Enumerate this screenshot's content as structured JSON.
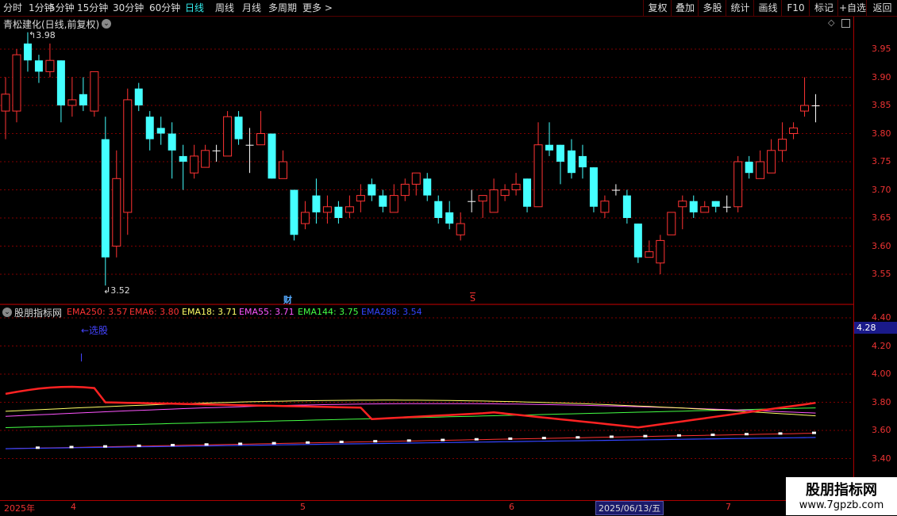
{
  "toolbar": {
    "tabs": [
      "分时",
      "1分钟",
      "5分钟",
      "15分钟",
      "30分钟",
      "60分钟",
      "日线",
      "周线",
      "月线",
      "多周期",
      "更多 >"
    ],
    "active_tab": "日线",
    "right_buttons": [
      "复权",
      "叠加",
      "多股",
      "统计",
      "画线",
      "F10",
      "标记",
      "+自选",
      "返回"
    ]
  },
  "main_panel": {
    "title": "青松建化(日线,前复权)",
    "high_marker": "3.98",
    "low_marker": "3.52",
    "event_markers": [
      "财",
      "S"
    ],
    "y_ticks": [
      "3.95",
      "3.90",
      "3.85",
      "3.80",
      "3.75",
      "3.70",
      "3.65",
      "3.60",
      "3.55"
    ]
  },
  "indicator_panel": {
    "title": "股朋指标网",
    "ema": [
      {
        "label": "EMA250: 3.57",
        "color": "#ff3333"
      },
      {
        "label": "EMA6: 3.80",
        "color": "#ff3333"
      },
      {
        "label": "EMA18: 3.71",
        "color": "#ffff66"
      },
      {
        "label": "EMA55: 3.71",
        "color": "#ff55ff"
      },
      {
        "label": "EMA144: 3.75",
        "color": "#44ff44"
      },
      {
        "label": "EMA288: 3.54",
        "color": "#3344ff"
      }
    ],
    "annotation": "←选股",
    "current_value": "4.28",
    "y_ticks": [
      "4.40",
      "4.20",
      "4.00",
      "3.80",
      "3.60",
      "3.40"
    ]
  },
  "date_axis": {
    "labels": [
      "2025年",
      "4",
      "5",
      "6",
      "7"
    ],
    "highlight": "2025/06/13/五"
  },
  "watermark": {
    "line1": "股朋指标网",
    "line2": "www.7gpzb.com"
  },
  "colors": {
    "up": "#ff3333",
    "down": "#44ffff",
    "grid": "#800000"
  },
  "chart_data": {
    "type": "candlestick",
    "price_range": [
      3.52,
      3.98
    ],
    "candles": [
      {
        "o": 3.84,
        "c": 3.87,
        "h": 3.9,
        "l": 3.79
      },
      {
        "o": 3.84,
        "c": 3.94,
        "h": 3.95,
        "l": 3.82
      },
      {
        "o": 3.96,
        "c": 3.93,
        "h": 3.98,
        "l": 3.91
      },
      {
        "o": 3.93,
        "c": 3.91,
        "h": 3.94,
        "l": 3.89
      },
      {
        "o": 3.91,
        "c": 3.93,
        "h": 3.96,
        "l": 3.9
      },
      {
        "o": 3.93,
        "c": 3.85,
        "h": 3.93,
        "l": 3.82
      },
      {
        "o": 3.85,
        "c": 3.86,
        "h": 3.9,
        "l": 3.83
      },
      {
        "o": 3.87,
        "c": 3.85,
        "h": 3.9,
        "l": 3.84
      },
      {
        "o": 3.84,
        "c": 3.91,
        "h": 3.91,
        "l": 3.83
      },
      {
        "o": 3.79,
        "c": 3.58,
        "h": 3.83,
        "l": 3.53
      },
      {
        "o": 3.6,
        "c": 3.72,
        "h": 3.77,
        "l": 3.58
      },
      {
        "o": 3.66,
        "c": 3.86,
        "h": 3.88,
        "l": 3.62
      },
      {
        "o": 3.88,
        "c": 3.85,
        "h": 3.89,
        "l": 3.84
      },
      {
        "o": 3.83,
        "c": 3.79,
        "h": 3.84,
        "l": 3.77
      },
      {
        "o": 3.81,
        "c": 3.8,
        "h": 3.83,
        "l": 3.78
      },
      {
        "o": 3.8,
        "c": 3.77,
        "h": 3.82,
        "l": 3.72
      },
      {
        "o": 3.76,
        "c": 3.75,
        "h": 3.78,
        "l": 3.7
      },
      {
        "o": 3.73,
        "c": 3.76,
        "h": 3.78,
        "l": 3.72
      },
      {
        "o": 3.74,
        "c": 3.77,
        "h": 3.78,
        "l": 3.74
      },
      {
        "o": 3.77,
        "c": 3.77,
        "h": 3.78,
        "l": 3.75
      },
      {
        "o": 3.76,
        "c": 3.83,
        "h": 3.84,
        "l": 3.76
      },
      {
        "o": 3.83,
        "c": 3.79,
        "h": 3.84,
        "l": 3.78
      },
      {
        "o": 3.78,
        "c": 3.78,
        "h": 3.81,
        "l": 3.73
      },
      {
        "o": 3.78,
        "c": 3.8,
        "h": 3.84,
        "l": 3.78
      },
      {
        "o": 3.8,
        "c": 3.72,
        "h": 3.8,
        "l": 3.72
      },
      {
        "o": 3.72,
        "c": 3.75,
        "h": 3.77,
        "l": 3.72
      },
      {
        "o": 3.7,
        "c": 3.62,
        "h": 3.7,
        "l": 3.61
      },
      {
        "o": 3.64,
        "c": 3.66,
        "h": 3.68,
        "l": 3.63
      },
      {
        "o": 3.69,
        "c": 3.66,
        "h": 3.72,
        "l": 3.64
      },
      {
        "o": 3.66,
        "c": 3.67,
        "h": 3.69,
        "l": 3.64
      },
      {
        "o": 3.67,
        "c": 3.65,
        "h": 3.68,
        "l": 3.64
      },
      {
        "o": 3.66,
        "c": 3.67,
        "h": 3.69,
        "l": 3.65
      },
      {
        "o": 3.68,
        "c": 3.69,
        "h": 3.71,
        "l": 3.66
      },
      {
        "o": 3.71,
        "c": 3.69,
        "h": 3.72,
        "l": 3.68
      },
      {
        "o": 3.69,
        "c": 3.67,
        "h": 3.7,
        "l": 3.66
      },
      {
        "o": 3.66,
        "c": 3.69,
        "h": 3.71,
        "l": 3.66
      },
      {
        "o": 3.69,
        "c": 3.71,
        "h": 3.72,
        "l": 3.68
      },
      {
        "o": 3.71,
        "c": 3.73,
        "h": 3.73,
        "l": 3.69
      },
      {
        "o": 3.72,
        "c": 3.69,
        "h": 3.73,
        "l": 3.68
      },
      {
        "o": 3.68,
        "c": 3.65,
        "h": 3.69,
        "l": 3.64
      },
      {
        "o": 3.66,
        "c": 3.64,
        "h": 3.68,
        "l": 3.63
      },
      {
        "o": 3.62,
        "c": 3.64,
        "h": 3.66,
        "l": 3.61
      },
      {
        "o": 3.68,
        "c": 3.68,
        "h": 3.7,
        "l": 3.66
      },
      {
        "o": 3.68,
        "c": 3.69,
        "h": 3.69,
        "l": 3.65
      },
      {
        "o": 3.66,
        "c": 3.7,
        "h": 3.72,
        "l": 3.66
      },
      {
        "o": 3.69,
        "c": 3.7,
        "h": 3.71,
        "l": 3.68
      },
      {
        "o": 3.7,
        "c": 3.71,
        "h": 3.73,
        "l": 3.69
      },
      {
        "o": 3.72,
        "c": 3.67,
        "h": 3.72,
        "l": 3.66
      },
      {
        "o": 3.67,
        "c": 3.78,
        "h": 3.82,
        "l": 3.67
      },
      {
        "o": 3.78,
        "c": 3.77,
        "h": 3.82,
        "l": 3.76
      },
      {
        "o": 3.78,
        "c": 3.75,
        "h": 3.78,
        "l": 3.71
      },
      {
        "o": 3.77,
        "c": 3.73,
        "h": 3.79,
        "l": 3.72
      },
      {
        "o": 3.76,
        "c": 3.74,
        "h": 3.78,
        "l": 3.72
      },
      {
        "o": 3.74,
        "c": 3.67,
        "h": 3.74,
        "l": 3.66
      },
      {
        "o": 3.66,
        "c": 3.68,
        "h": 3.69,
        "l": 3.65
      },
      {
        "o": 3.7,
        "c": 3.7,
        "h": 3.71,
        "l": 3.69
      },
      {
        "o": 3.69,
        "c": 3.65,
        "h": 3.7,
        "l": 3.64
      },
      {
        "o": 3.64,
        "c": 3.58,
        "h": 3.64,
        "l": 3.57
      },
      {
        "o": 3.58,
        "c": 3.59,
        "h": 3.61,
        "l": 3.58
      },
      {
        "o": 3.57,
        "c": 3.61,
        "h": 3.62,
        "l": 3.55
      },
      {
        "o": 3.62,
        "c": 3.66,
        "h": 3.66,
        "l": 3.62
      },
      {
        "o": 3.67,
        "c": 3.68,
        "h": 3.69,
        "l": 3.63
      },
      {
        "o": 3.68,
        "c": 3.66,
        "h": 3.69,
        "l": 3.65
      },
      {
        "o": 3.66,
        "c": 3.67,
        "h": 3.68,
        "l": 3.66
      },
      {
        "o": 3.68,
        "c": 3.67,
        "h": 3.68,
        "l": 3.66
      },
      {
        "o": 3.67,
        "c": 3.67,
        "h": 3.69,
        "l": 3.66
      },
      {
        "o": 3.67,
        "c": 3.75,
        "h": 3.76,
        "l": 3.66
      },
      {
        "o": 3.75,
        "c": 3.73,
        "h": 3.76,
        "l": 3.72
      },
      {
        "o": 3.72,
        "c": 3.75,
        "h": 3.77,
        "l": 3.72
      },
      {
        "o": 3.73,
        "c": 3.77,
        "h": 3.79,
        "l": 3.73
      },
      {
        "o": 3.77,
        "c": 3.79,
        "h": 3.82,
        "l": 3.75
      },
      {
        "o": 3.8,
        "c": 3.81,
        "h": 3.82,
        "l": 3.79
      },
      {
        "o": 3.84,
        "c": 3.85,
        "h": 3.9,
        "l": 3.83
      },
      {
        "o": 3.85,
        "c": 3.85,
        "h": 3.87,
        "l": 3.82
      }
    ],
    "series": [
      {
        "name": "EMA250",
        "color": "#3344ff"
      },
      {
        "name": "EMA6",
        "color": "#ff3333"
      },
      {
        "name": "EMA18",
        "color": "#ffff66"
      },
      {
        "name": "EMA55",
        "color": "#ff55ff"
      },
      {
        "name": "EMA144",
        "color": "#44ff44"
      },
      {
        "name": "EMA288",
        "color": "#3344ff"
      }
    ]
  }
}
